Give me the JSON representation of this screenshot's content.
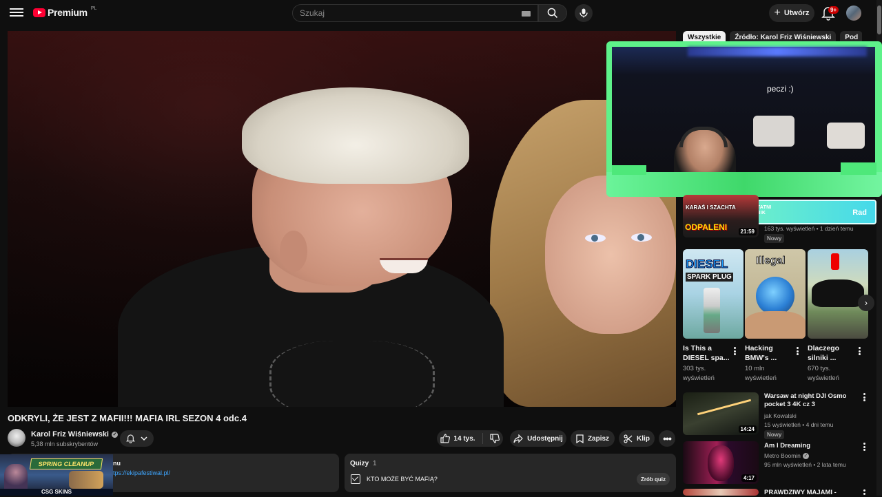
{
  "header": {
    "logo_text": "Premium",
    "logo_country": "PL",
    "search_placeholder": "Szukaj",
    "create_label": "Utwórz",
    "notifications_badge": "9+"
  },
  "chips": [
    "Wszystkie",
    "Źródło: Karol Friz Wiśniewski",
    "Pod"
  ],
  "video": {
    "title": "ODKRYLI, ŻE JEST Z MAFII!!! MAFIA IRL SEZON 4 odc.4",
    "channel": "Karol Friz Wiśniewski",
    "subscribers": "5,38 mln subskrybentów",
    "likes": "14 tys.",
    "share_label": "Udostępnij",
    "save_label": "Zapisz",
    "clip_label": "Klip"
  },
  "description": {
    "text_partial": "nu",
    "link_partial": "tps://ekipafestiwal.pl/"
  },
  "quiz": {
    "title": "Quizy",
    "count": "1",
    "question": "KTO MOŻE BYĆ MAFIĄ?",
    "button": "Zrób quiz"
  },
  "pip_overlay": {
    "caption": "peczi :)",
    "bar_label_top": "OSTATNI",
    "bar_label_bottom": "SUBIK",
    "bar_name": "Rad"
  },
  "ad_thumb": {
    "banner": "SPRING CLEANUP",
    "brand": "CSG SKINS"
  },
  "recommendations": {
    "top": {
      "thumb_line1": "KARAŚ I SZACHTA",
      "thumb_line2": "ODPALENI",
      "duration": "21:59",
      "meta": "163 tys. wyświetleń • 1 dzień temu",
      "badge": "Nowy"
    },
    "shorts": [
      {
        "title": "Is This a DIESEL spa...",
        "views": "303 tys. wyświetleń",
        "thumb_text1": "DIESEL",
        "thumb_text2": "SPARK PLUG"
      },
      {
        "title": "Hacking BMW's ...",
        "views": "10 mln wyświetleń",
        "thumb_text1": "Illegal"
      },
      {
        "title": "Dlaczego silniki ...",
        "views": "670 tys. wyświetleń"
      }
    ],
    "list": [
      {
        "title": "Warsaw at night  DJI Osmo pocket 3 4K cz  3",
        "channel": "jak Kowalski",
        "meta": "15 wyświetleń • 4 dni temu",
        "badge": "Nowy",
        "duration": "14:24"
      },
      {
        "title": "Am I Dreaming",
        "channel": "Metro Boomin",
        "meta": "95 mln wyświetleń • 2 lata temu",
        "duration": "4:17"
      },
      {
        "title": "PRAWDZIWY MAJAMI -",
        "channel": "",
        "meta": ""
      }
    ]
  }
}
